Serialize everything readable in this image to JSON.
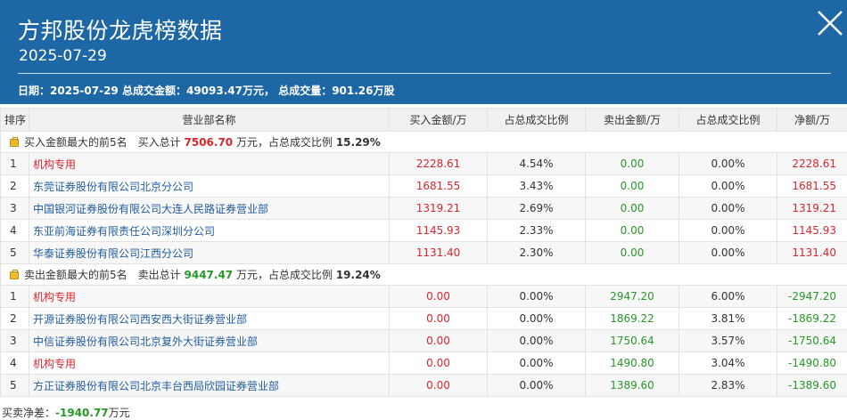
{
  "header": {
    "title": "方邦股份龙虎榜数据",
    "date": "2025-07-29",
    "summary_date_label": "日期：",
    "summary_date": "2025-07-29",
    "summary_turnover_label": "总成交金额：",
    "summary_turnover": "49093.47万元",
    "summary_volume_label": "总成交量：",
    "summary_volume": "901.26万股"
  },
  "columns": [
    "排序",
    "营业部名称",
    "买入金额/万",
    "占总成交比例",
    "卖出金额/万",
    "占总成交比例",
    "净额/万"
  ],
  "buy_section": {
    "label": "买入金额最大的前5名",
    "total_label": "买入总计",
    "total_value": "7506.70",
    "unit_label": "万元，占总成交比例",
    "ratio": "15.29%",
    "rows": [
      {
        "rank": "1",
        "name": "机构专用",
        "buy": "2228.61",
        "buy_ratio": "4.54%",
        "sell": "0.00",
        "sell_ratio": "0.00%",
        "net": "2228.61",
        "inst": true
      },
      {
        "rank": "2",
        "name": "东莞证券股份有限公司北京分公司",
        "buy": "1681.55",
        "buy_ratio": "3.43%",
        "sell": "0.00",
        "sell_ratio": "0.00%",
        "net": "1681.55",
        "inst": false
      },
      {
        "rank": "3",
        "name": "中国银河证券股份有限公司大连人民路证券营业部",
        "buy": "1319.21",
        "buy_ratio": "2.69%",
        "sell": "0.00",
        "sell_ratio": "0.00%",
        "net": "1319.21",
        "inst": false
      },
      {
        "rank": "4",
        "name": "东亚前海证券有限责任公司深圳分公司",
        "buy": "1145.93",
        "buy_ratio": "2.33%",
        "sell": "0.00",
        "sell_ratio": "0.00%",
        "net": "1145.93",
        "inst": false
      },
      {
        "rank": "5",
        "name": "华泰证券股份有限公司江西分公司",
        "buy": "1131.40",
        "buy_ratio": "2.30%",
        "sell": "0.00",
        "sell_ratio": "0.00%",
        "net": "1131.40",
        "inst": false
      }
    ]
  },
  "sell_section": {
    "label": "卖出金额最大的前5名",
    "total_label": "卖出总计",
    "total_value": "9447.47",
    "unit_label": "万元，占总成交比例",
    "ratio": "19.24%",
    "rows": [
      {
        "rank": "1",
        "name": "机构专用",
        "buy": "0.00",
        "buy_ratio": "0.00%",
        "sell": "2947.20",
        "sell_ratio": "6.00%",
        "net": "-2947.20",
        "inst": true
      },
      {
        "rank": "2",
        "name": "开源证券股份有限公司西安西大街证券营业部",
        "buy": "0.00",
        "buy_ratio": "0.00%",
        "sell": "1869.22",
        "sell_ratio": "3.81%",
        "net": "-1869.22",
        "inst": false
      },
      {
        "rank": "3",
        "name": "中信证券股份有限公司北京复外大街证券营业部",
        "buy": "0.00",
        "buy_ratio": "0.00%",
        "sell": "1750.64",
        "sell_ratio": "3.57%",
        "net": "-1750.64",
        "inst": false
      },
      {
        "rank": "4",
        "name": "机构专用",
        "buy": "0.00",
        "buy_ratio": "0.00%",
        "sell": "1490.80",
        "sell_ratio": "3.04%",
        "net": "-1490.80",
        "inst": true
      },
      {
        "rank": "5",
        "name": "方正证券股份有限公司北京丰台西局欣园证券营业部",
        "buy": "0.00",
        "buy_ratio": "0.00%",
        "sell": "1389.60",
        "sell_ratio": "2.83%",
        "net": "-1389.60",
        "inst": false
      }
    ]
  },
  "footer": {
    "label": "买卖净差：",
    "value": "-1940.77",
    "unit": "万元"
  },
  "colors": {
    "header_bg": "#1e67a5",
    "red": "#d8262d",
    "green": "#269826",
    "link_blue": "#1f5b9c"
  },
  "icons": {
    "close": "close-icon",
    "section": "briefcase-icon"
  }
}
